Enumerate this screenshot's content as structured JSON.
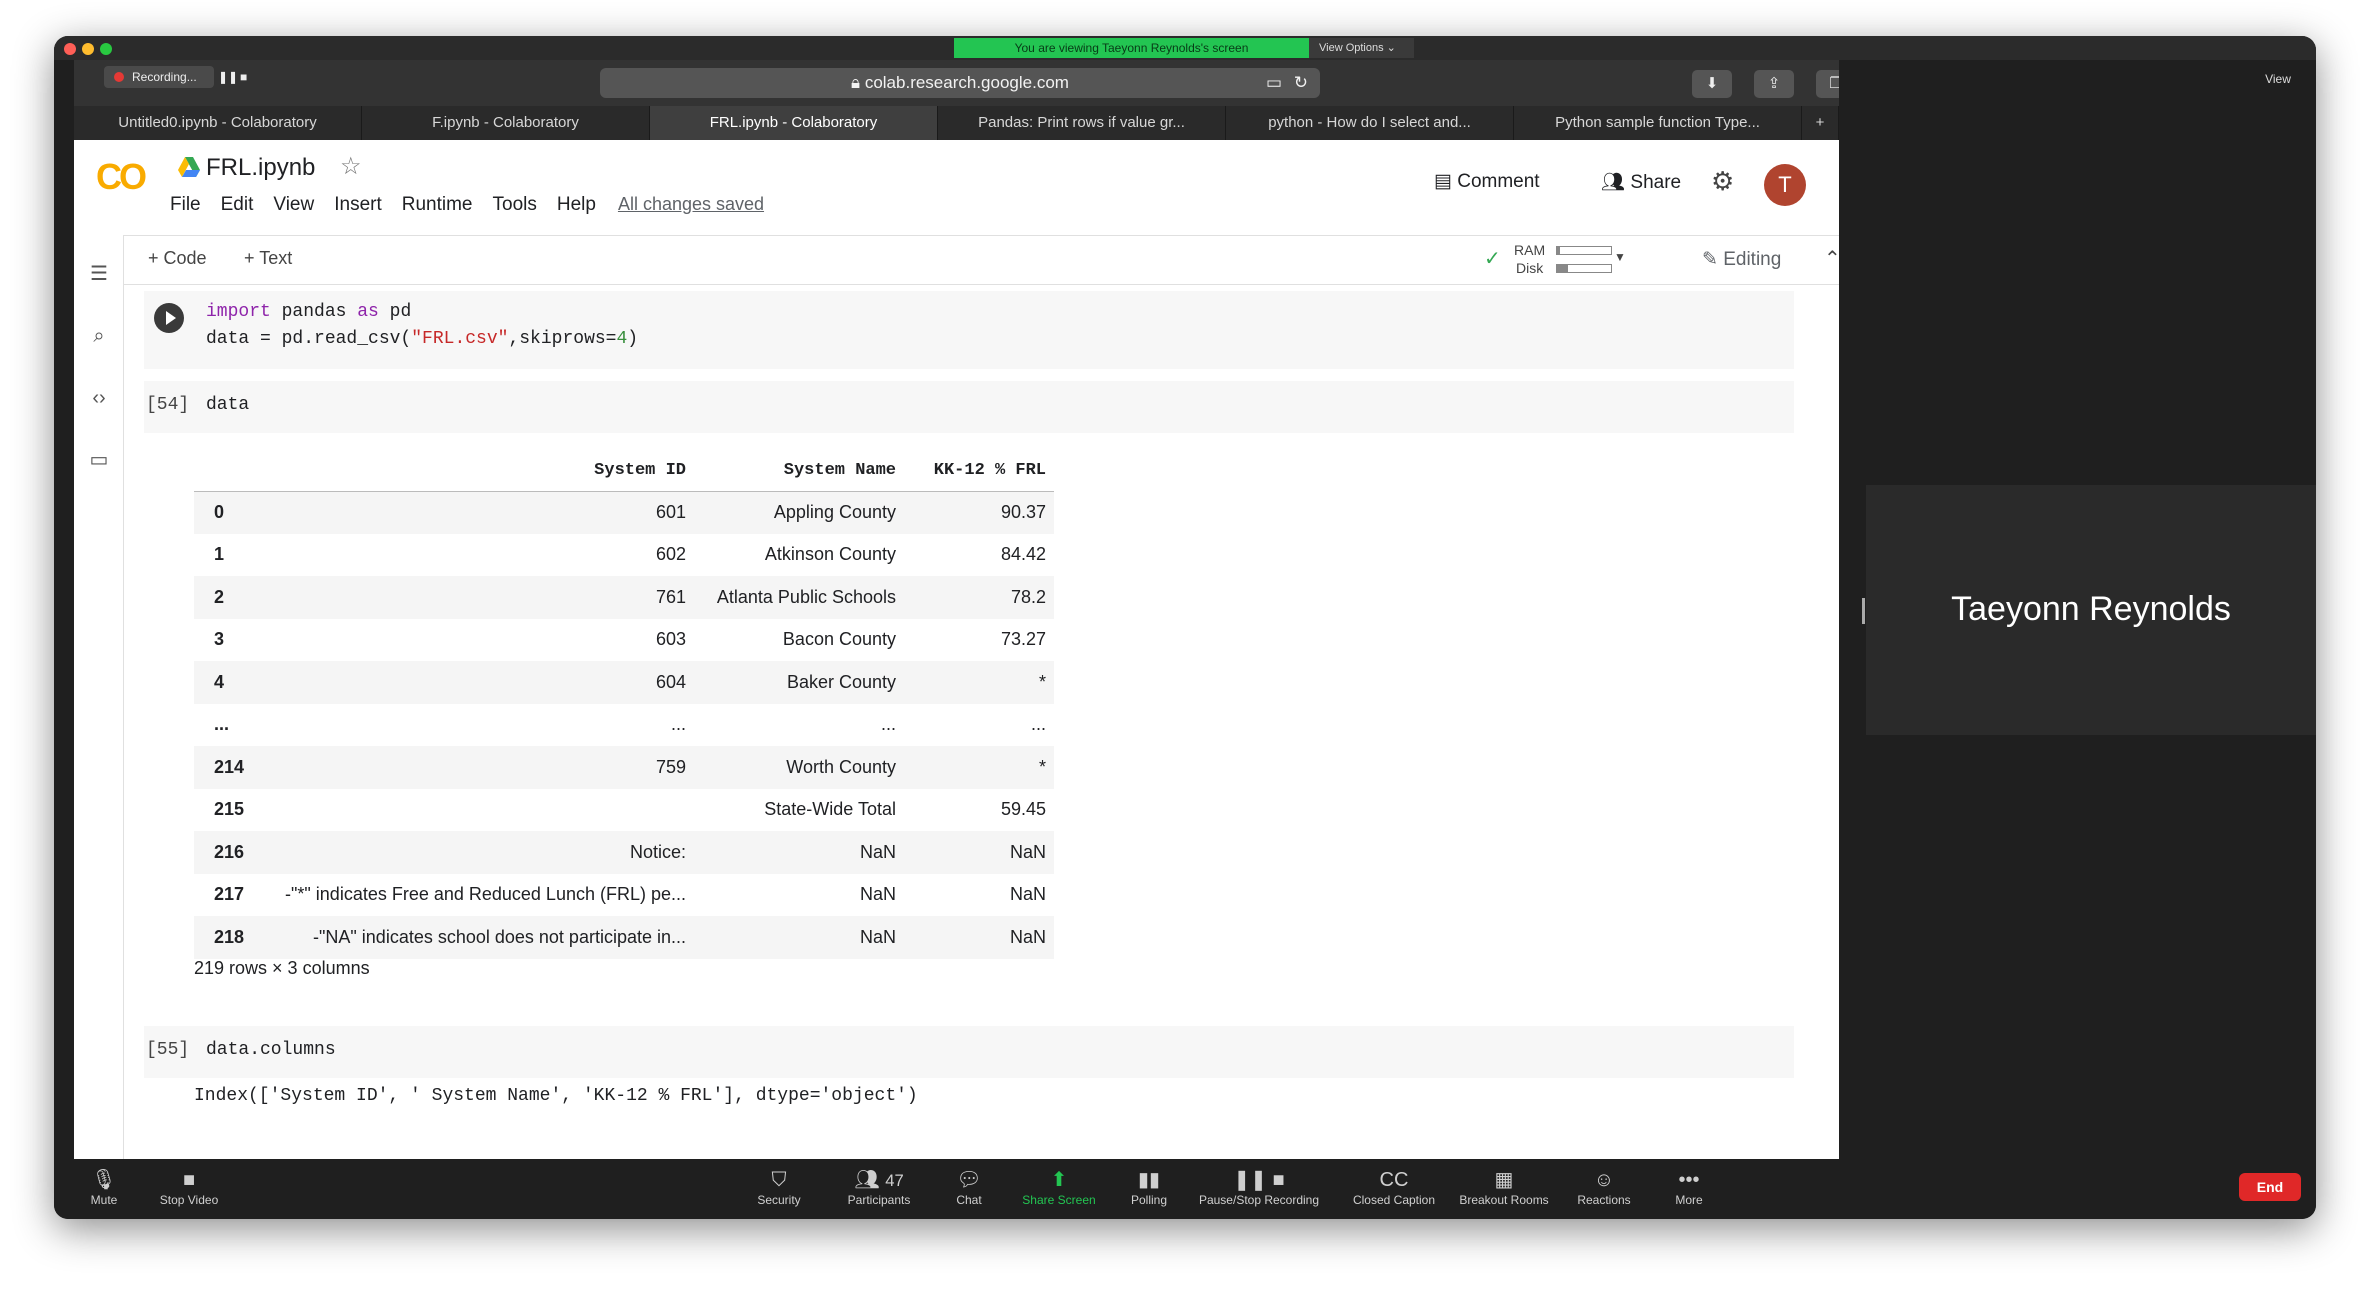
{
  "zoom": {
    "viewing_banner": "You are viewing Taeyonn Reynolds's screen",
    "view_options": "View Options ⌄",
    "view_button": "View",
    "recording_label": "Recording...",
    "participant_name": "Taeyonn Reynolds",
    "bottom_bar": [
      {
        "label": "Mute",
        "icon": "microphone-icon"
      },
      {
        "label": "Stop Video",
        "icon": "video-camera-icon"
      },
      {
        "label": "Security",
        "icon": "shield-icon"
      },
      {
        "label": "Participants",
        "icon": "participants-icon",
        "count": "47"
      },
      {
        "label": "Chat",
        "icon": "chat-icon"
      },
      {
        "label": "Share Screen",
        "icon": "share-screen-icon"
      },
      {
        "label": "Polling",
        "icon": "polling-icon"
      },
      {
        "label": "Pause/Stop Recording",
        "icon": "pause-stop-icon"
      },
      {
        "label": "Closed Caption",
        "icon": "cc-icon"
      },
      {
        "label": "Breakout Rooms",
        "icon": "breakout-icon"
      },
      {
        "label": "Reactions",
        "icon": "reactions-icon"
      },
      {
        "label": "More",
        "icon": "more-icon"
      }
    ],
    "end_button": "End",
    "colors": {
      "banner": "#23c552",
      "end": "#e02828",
      "share_active": "#23c552"
    }
  },
  "browser": {
    "url": "colab.research.google.com",
    "tabs": [
      "Untitled0.ipynb - Colaboratory",
      "F.ipynb - Colaboratory",
      "FRL.ipynb - Colaboratory",
      "Pandas: Print rows if value gr...",
      "python - How do I select and...",
      "Python sample function Type..."
    ],
    "active_tab": 2
  },
  "colab": {
    "logo": "CO",
    "notebook_title": "FRL.ipynb",
    "menu": [
      "File",
      "Edit",
      "View",
      "Insert",
      "Runtime",
      "Tools",
      "Help"
    ],
    "saved_status": "All changes saved",
    "comment": "Comment",
    "share": "Share",
    "avatar_initial": "T",
    "add_code": "+ Code",
    "add_text": "+ Text",
    "ram_label": "RAM",
    "disk_label": "Disk",
    "editing": "Editing"
  },
  "cells": {
    "cell1": {
      "line1": [
        "import",
        " pandas ",
        "as",
        " pd"
      ],
      "line2": [
        "data = pd.read_csv(",
        "\"FRL.csv\"",
        ",skiprows=",
        "4",
        ")"
      ]
    },
    "cell54": {
      "count": "[54]",
      "code": "data"
    },
    "cell55": {
      "count": "[55]",
      "code": "data.columns",
      "output": "Index(['System ID', ' System Name', 'KK-12 % FRL'], dtype='object')"
    }
  },
  "dataframe": {
    "columns": [
      "",
      "System ID",
      "System Name",
      "KK-12 % FRL"
    ],
    "rows": [
      [
        "0",
        "601",
        "Appling County",
        "90.37"
      ],
      [
        "1",
        "602",
        "Atkinson County",
        "84.42"
      ],
      [
        "2",
        "761",
        "Atlanta Public Schools",
        "78.2"
      ],
      [
        "3",
        "603",
        "Bacon County",
        "73.27"
      ],
      [
        "4",
        "604",
        "Baker County",
        "*"
      ],
      [
        "...",
        "...",
        "...",
        "..."
      ],
      [
        "214",
        "759",
        "Worth County",
        "*"
      ],
      [
        "215",
        "",
        "State-Wide Total",
        "59.45"
      ],
      [
        "216",
        "Notice:",
        "NaN",
        "NaN"
      ],
      [
        "217",
        "-\"*\" indicates Free and Reduced Lunch (FRL) pe...",
        "NaN",
        "NaN"
      ],
      [
        "218",
        "-\"NA\" indicates school does not participate in...",
        "NaN",
        "NaN"
      ]
    ],
    "shape": "219 rows × 3 columns"
  }
}
